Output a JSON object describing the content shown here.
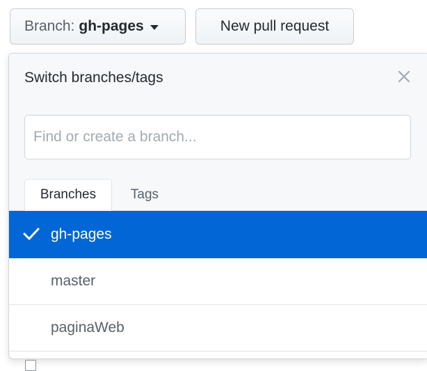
{
  "toolbar": {
    "branch_prefix": "Branch:",
    "branch_name": "gh-pages",
    "new_pr_label": "New pull request"
  },
  "menu": {
    "title": "Switch branches/tags",
    "filter_placeholder": "Find or create a branch...",
    "tabs": [
      {
        "label": "Branches",
        "selected": true
      },
      {
        "label": "Tags",
        "selected": false
      }
    ],
    "items": [
      {
        "label": "gh-pages",
        "selected": true
      },
      {
        "label": "master",
        "selected": false
      },
      {
        "label": "paginaWeb",
        "selected": false
      }
    ]
  },
  "icons": {
    "close": "close-icon",
    "check": "check-icon",
    "caret": "caret-down-icon"
  },
  "colors": {
    "selected_background": "#0366d6",
    "header_background": "#f6f8fa",
    "border": "#e1e4e8"
  }
}
